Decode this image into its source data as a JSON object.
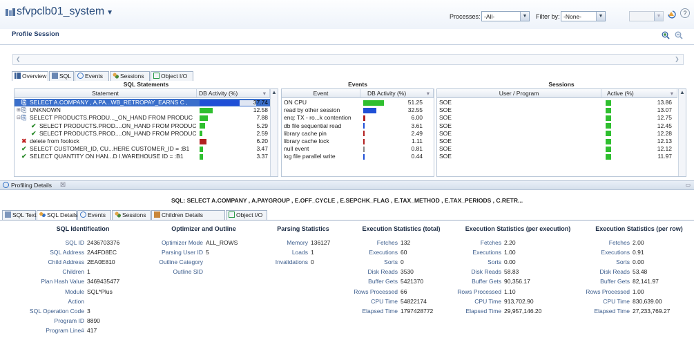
{
  "header": {
    "title": "sfvpclb01_system",
    "processes_label": "Processes:",
    "processes_value": "-All-",
    "filter_label": "Filter by:",
    "filter_value": "-None-",
    "help": "?"
  },
  "session": {
    "title": "Profile Session"
  },
  "top_tabs": [
    {
      "label": "Overview"
    },
    {
      "label": "SQL"
    },
    {
      "label": "Events"
    },
    {
      "label": "Sessions"
    },
    {
      "label": "Object I/O"
    }
  ],
  "sql_panel": {
    "title": "SQL Statements",
    "col_statement": "Statement",
    "col_activity": "DB Activity (%)",
    "rows": [
      {
        "text": "SELECT A.COMPANY , A.PA...WB_RETROPAY_EARNS C ,",
        "value": "37.74",
        "pct": 37.74,
        "color": "#1f4fd6",
        "icon": "sql"
      },
      {
        "text": "UNKNOWN",
        "value": "12.58",
        "pct": 12.58,
        "color": "#2fbf2f",
        "icon": "unknown"
      },
      {
        "text": "SELECT PRODUCTS.PRODU..._ON_HAND FROM PRODUC",
        "value": "7.88",
        "pct": 7.88,
        "color": "#2fbf2f",
        "icon": "sql"
      },
      {
        "text": "SELECT PRODUCTS.PROD....ON_HAND FROM PRODUC",
        "value": "5.29",
        "pct": 5.29,
        "color": "#2fbf2f",
        "icon": "check"
      },
      {
        "text": "SELECT PRODUCTS.PROD....ON_HAND FROM PRODUC",
        "value": "2.59",
        "pct": 2.59,
        "color": "#2fbf2f",
        "icon": "check"
      },
      {
        "text": "delete from foolock",
        "value": "6.20",
        "pct": 6.2,
        "color": "#b21f1f",
        "icon": "x"
      },
      {
        "text": "SELECT CUSTOMER_ID, CU...HERE CUSTOMER_ID = :B1",
        "value": "3.47",
        "pct": 3.47,
        "color": "#2fbf2f",
        "icon": "check"
      },
      {
        "text": "SELECT QUANTITY ON HAN...D I.WAREHOUSE ID = :B1",
        "value": "3.37",
        "pct": 3.37,
        "color": "#2fbf2f",
        "icon": "check"
      }
    ]
  },
  "events_panel": {
    "title": "Events",
    "col_event": "Event",
    "col_activity": "DB Activity (%)",
    "rows": [
      {
        "text": "ON CPU",
        "value": "51.25",
        "pct": 51.25,
        "color": "#2fbf2f"
      },
      {
        "text": "read by other session",
        "value": "32.55",
        "pct": 32.55,
        "color": "#1f4fd6"
      },
      {
        "text": "enq: TX - ro...k contention",
        "value": "6.00",
        "pct": 6.0,
        "color": "#b21f1f"
      },
      {
        "text": "db file sequential read",
        "value": "3.61",
        "pct": 3.61,
        "color": "#1f4fd6"
      },
      {
        "text": "library cache pin",
        "value": "2.49",
        "pct": 2.49,
        "color": "#b21f1f"
      },
      {
        "text": "library cache lock",
        "value": "1.11",
        "pct": 1.11,
        "color": "#b21f1f"
      },
      {
        "text": "null event",
        "value": "0.81",
        "pct": 0.81,
        "color": "#888888"
      },
      {
        "text": "log file parallel write",
        "value": "0.44",
        "pct": 0.44,
        "color": "#1f4fd6"
      }
    ]
  },
  "sessions_panel": {
    "title": "Sessions",
    "col_user": "User / Program",
    "col_active": "Active (%)",
    "rows": [
      {
        "text": "SOE",
        "value": "13.86"
      },
      {
        "text": "SOE",
        "value": "13.07"
      },
      {
        "text": "SOE",
        "value": "12.75"
      },
      {
        "text": "SOE",
        "value": "12.45"
      },
      {
        "text": "SOE",
        "value": "12.28"
      },
      {
        "text": "SOE",
        "value": "12.13"
      },
      {
        "text": "SOE",
        "value": "12.12"
      },
      {
        "text": "SOE",
        "value": "11.97"
      }
    ]
  },
  "profiling": {
    "title": "Profiling Details",
    "close": "☒",
    "sql_text": "SQL: SELECT A.COMPANY , A.PAYGROUP , E.OFF_CYCLE , E.SEPCHK_FLAG , E.TAX_METHOD , E.TAX_PERIODS , C.RETR..."
  },
  "detail_tabs": [
    {
      "label": "SQL Text"
    },
    {
      "label": "SQL Details"
    },
    {
      "label": "Events"
    },
    {
      "label": "Sessions"
    },
    {
      "label": "Children Details"
    },
    {
      "label": "Object I/O"
    }
  ],
  "sections": [
    {
      "title": "SQL Identification",
      "items": [
        {
          "k": "SQL ID",
          "v": "2436703376"
        },
        {
          "k": "SQL Address",
          "v": "2A4FD8EC"
        },
        {
          "k": "Child Address",
          "v": "2EA0E810"
        },
        {
          "k": "Children",
          "v": "1"
        },
        {
          "k": "Plan Hash Value",
          "v": "3469435477"
        },
        {
          "k": "Module",
          "v": "SQL*Plus"
        },
        {
          "k": "Action",
          "v": ""
        },
        {
          "k": "SQL Operation Code",
          "v": "3"
        },
        {
          "k": "Program ID",
          "v": "8890"
        },
        {
          "k": "Program Line#",
          "v": "417"
        }
      ]
    },
    {
      "title": "Optimizer and Outline",
      "items": [
        {
          "k": "Optimizer Mode",
          "v": "ALL_ROWS"
        },
        {
          "k": "Parsing User ID",
          "v": "5"
        },
        {
          "k": "Outline Category",
          "v": ""
        },
        {
          "k": "Outline SID",
          "v": ""
        }
      ]
    },
    {
      "title": "Parsing Statistics",
      "items": [
        {
          "k": "Memory",
          "v": "136127"
        },
        {
          "k": "Loads",
          "v": "1"
        },
        {
          "k": "Invalidations",
          "v": "0"
        }
      ]
    },
    {
      "title": "Execution Statistics (total)",
      "items": [
        {
          "k": "Fetches",
          "v": "132"
        },
        {
          "k": "Executions",
          "v": "60"
        },
        {
          "k": "Sorts",
          "v": "0"
        },
        {
          "k": "Disk Reads",
          "v": "3530"
        },
        {
          "k": "Buffer Gets",
          "v": "5421370"
        },
        {
          "k": "Rows Processed",
          "v": "66"
        },
        {
          "k": "CPU Time",
          "v": "54822174"
        },
        {
          "k": "Elapsed Time",
          "v": "1797428772"
        }
      ]
    },
    {
      "title": "Execution Statistics (per execution)",
      "items": [
        {
          "k": "Fetches",
          "v": "2.20"
        },
        {
          "k": "Executions",
          "v": "1.00"
        },
        {
          "k": "Sorts",
          "v": "0.00"
        },
        {
          "k": "Disk Reads",
          "v": "58.83"
        },
        {
          "k": "Buffer Gets",
          "v": "90,356.17"
        },
        {
          "k": "Rows Processed",
          "v": "1.10"
        },
        {
          "k": "CPU Time",
          "v": "913,702.90"
        },
        {
          "k": "Elapsed Time",
          "v": "29,957,146.20"
        }
      ]
    },
    {
      "title": "Execution Statistics (per row)",
      "items": [
        {
          "k": "Fetches",
          "v": "2.00"
        },
        {
          "k": "Executions",
          "v": "0.91"
        },
        {
          "k": "Sorts",
          "v": "0.00"
        },
        {
          "k": "Disk Reads",
          "v": "53.48"
        },
        {
          "k": "Buffer Gets",
          "v": "82,141.97"
        },
        {
          "k": "Rows Processed",
          "v": "1.00"
        },
        {
          "k": "CPU Time",
          "v": "830,639.00"
        },
        {
          "k": "Elapsed Time",
          "v": "27,233,769.27"
        }
      ]
    }
  ]
}
